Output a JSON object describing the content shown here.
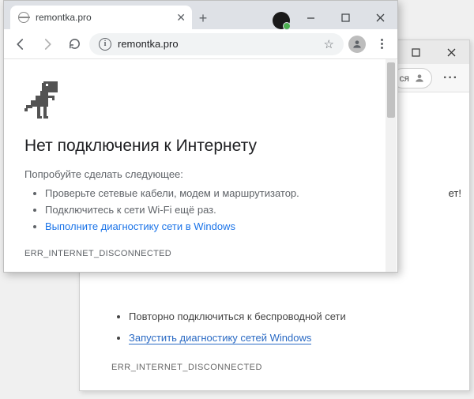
{
  "back_window": {
    "toolbar_text_fragment": "ся",
    "content_fragment": "ет!",
    "suggestions": [
      "Повторно подключиться к беспроводной сети",
      "Запустить диагностику сетей Windows"
    ],
    "link_index": 1,
    "error_code": "ERR_INTERNET_DISCONNECTED"
  },
  "front_window": {
    "tab_title": "remontka.pro",
    "url": "remontka.pro",
    "page": {
      "heading": "Нет подключения к Интернету",
      "subheading": "Попробуйте сделать следующее:",
      "suggestions": [
        "Проверьте сетевые кабели, модем и маршрутизатор.",
        "Подключитесь к сети Wi-Fi ещё раз.",
        "Выполните диагностику сети в Windows"
      ],
      "link_index": 2,
      "error_code": "ERR_INTERNET_DISCONNECTED"
    }
  }
}
